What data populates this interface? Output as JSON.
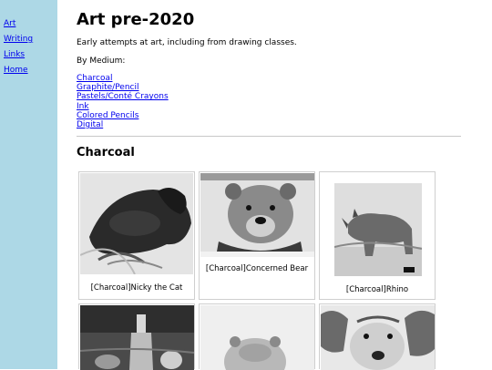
{
  "sidebar": {
    "links": [
      {
        "label": "Art"
      },
      {
        "label": "Writing"
      },
      {
        "label": "Links"
      },
      {
        "label": "Home"
      }
    ]
  },
  "page": {
    "title": "Art pre-2020",
    "intro": "Early attempts at art, including from drawing classes.",
    "by_medium_label": "By Medium:",
    "mediums": [
      "Charcoal",
      "Graphite/Pencil",
      "Pastels/Conté Crayons",
      "Ink",
      "Colored Pencils",
      "Digital"
    ],
    "section_title": "Charcoal"
  },
  "gallery": [
    {
      "caption": "[Charcoal]Nicky the Cat",
      "subject": "cat-drawing"
    },
    {
      "caption": "[Charcoal]Concerned Bear",
      "subject": "bear-drawing"
    },
    {
      "caption": "[Charcoal]Rhino",
      "subject": "rhino-drawing"
    },
    {
      "caption": "",
      "subject": "bottle-still-life-drawing"
    },
    {
      "caption": "",
      "subject": "hippo-drawing"
    },
    {
      "caption": "",
      "subject": "dog-drawing"
    }
  ]
}
